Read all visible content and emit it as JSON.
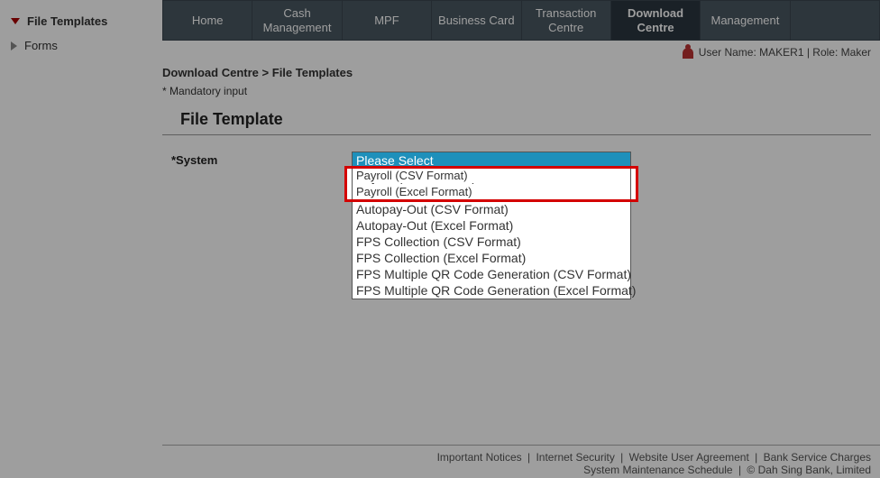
{
  "sidebar": {
    "items": [
      {
        "label": "File Templates",
        "expanded": true
      },
      {
        "label": "Forms",
        "expanded": false
      }
    ]
  },
  "topnav": {
    "items": [
      {
        "label": "Home"
      },
      {
        "label": "Cash Management"
      },
      {
        "label": "MPF"
      },
      {
        "label": "Business Card"
      },
      {
        "label": "Transaction Centre"
      },
      {
        "label": "Download Centre",
        "active": true
      },
      {
        "label": "Management"
      }
    ]
  },
  "user": {
    "name_label": "User Name:",
    "name_value": "MAKER1",
    "role_label": "Role:",
    "role_value": "Maker"
  },
  "breadcrumb": {
    "part1": "Download Centre",
    "sep": ">",
    "part2": "File Templates"
  },
  "mandatory_note": "* Mandatory input",
  "page_title": "File Template",
  "form": {
    "system_label": "*System",
    "options": [
      "Please Select",
      "Payroll (CSV Format)",
      "Payroll (Excel Format)",
      "Autopay-Out (CSV Format)",
      "Autopay-Out (Excel Format)",
      "FPS Collection (CSV Format)",
      "FPS Collection (Excel Format)",
      "FPS Multiple QR Code Generation (CSV Format)",
      "FPS Multiple QR Code Generation (Excel Format)"
    ],
    "selected_index": 0,
    "highlight_start": 1,
    "highlight_end": 2
  },
  "footer": {
    "links": [
      "Important Notices",
      "Internet Security",
      "Website User Agreement",
      "Bank Service Charges",
      "System Maintenance Schedule"
    ],
    "copyright": "© Dah Sing Bank, Limited"
  }
}
